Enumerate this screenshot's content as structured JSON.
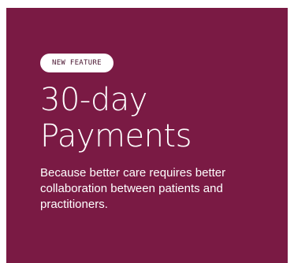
{
  "promo": {
    "badge": "NEW FEATURE",
    "headline_line1": "30-day",
    "headline_line2": "Payments",
    "description": "Because better care requires better collaboration between patients and practitioners."
  },
  "colors": {
    "card_background": "#7a1a44",
    "text": "#ffffff",
    "badge_background": "#ffffff",
    "badge_text": "#4a1530"
  }
}
